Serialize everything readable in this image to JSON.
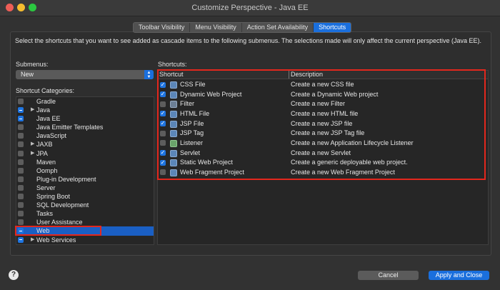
{
  "window": {
    "title": "Customize Perspective - Java EE"
  },
  "tabs": [
    {
      "label": "Toolbar Visibility",
      "active": false
    },
    {
      "label": "Menu Visibility",
      "active": false
    },
    {
      "label": "Action Set Availability",
      "active": false
    },
    {
      "label": "Shortcuts",
      "active": true
    }
  ],
  "description": "Select the shortcuts that you want to see added as cascade items to the following submenus. The selections made will only affect the current perspective (Java EE).",
  "submenus": {
    "label": "Submenus:",
    "selected": "New"
  },
  "categories_label": "Shortcut Categories:",
  "categories": [
    {
      "label": "Gradle",
      "state": "unchecked",
      "expandable": false
    },
    {
      "label": "Java",
      "state": "partial",
      "expandable": true
    },
    {
      "label": "Java EE",
      "state": "partial",
      "expandable": false
    },
    {
      "label": "Java Emitter Templates",
      "state": "unchecked",
      "expandable": false
    },
    {
      "label": "JavaScript",
      "state": "unchecked",
      "expandable": false
    },
    {
      "label": "JAXB",
      "state": "unchecked",
      "expandable": true
    },
    {
      "label": "JPA",
      "state": "unchecked",
      "expandable": true
    },
    {
      "label": "Maven",
      "state": "unchecked",
      "expandable": false
    },
    {
      "label": "Oomph",
      "state": "unchecked",
      "expandable": false
    },
    {
      "label": "Plug-in Development",
      "state": "unchecked",
      "expandable": false
    },
    {
      "label": "Server",
      "state": "unchecked",
      "expandable": false
    },
    {
      "label": "Spring Boot",
      "state": "unchecked",
      "expandable": false
    },
    {
      "label": "SQL Development",
      "state": "unchecked",
      "expandable": false
    },
    {
      "label": "Tasks",
      "state": "unchecked",
      "expandable": false
    },
    {
      "label": "User Assistance",
      "state": "unchecked",
      "expandable": false
    },
    {
      "label": "Web",
      "state": "partial",
      "expandable": false,
      "selected": true
    },
    {
      "label": "Web Services",
      "state": "partial",
      "expandable": true
    }
  ],
  "shortcuts_label": "Shortcuts:",
  "shortcut_columns": {
    "shortcut": "Shortcut",
    "description": "Description"
  },
  "shortcuts": [
    {
      "name": "CSS File",
      "description": "Create a new CSS file",
      "checked": true,
      "icon": "file-icon"
    },
    {
      "name": "Dynamic Web Project",
      "description": "Create a Dynamic Web project",
      "checked": true,
      "icon": "project-icon"
    },
    {
      "name": "Filter",
      "description": "Create a new Filter",
      "checked": false,
      "icon": "filter-icon"
    },
    {
      "name": "HTML File",
      "description": "Create a new HTML file",
      "checked": true,
      "icon": "file-icon"
    },
    {
      "name": "JSP File",
      "description": "Create a new JSP file",
      "checked": true,
      "icon": "file-icon"
    },
    {
      "name": "JSP Tag",
      "description": "Create a new JSP Tag file",
      "checked": false,
      "icon": "file-icon"
    },
    {
      "name": "Listener",
      "description": "Create a new Application Lifecycle Listener",
      "checked": false,
      "icon": "listener-icon"
    },
    {
      "name": "Servlet",
      "description": "Create a new Servlet",
      "checked": true,
      "icon": "servlet-icon"
    },
    {
      "name": "Static Web Project",
      "description": "Create a generic deployable web project.",
      "checked": true,
      "icon": "project-icon"
    },
    {
      "name": "Web Fragment Project",
      "description": "Create a new Web Fragment Project",
      "checked": false,
      "icon": "project-icon"
    }
  ],
  "buttons": {
    "help": "?",
    "cancel": "Cancel",
    "apply": "Apply and Close"
  },
  "colors": {
    "accent": "#1a6fdd",
    "highlight": "#e3271d"
  }
}
